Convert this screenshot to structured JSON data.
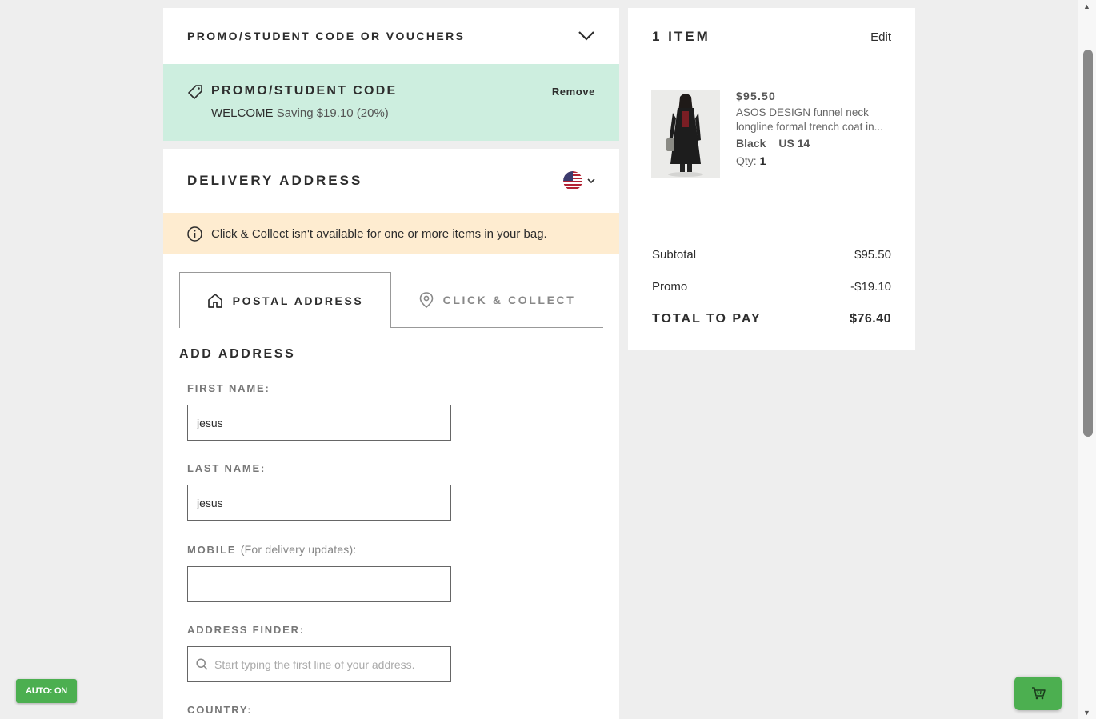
{
  "promo_section": {
    "title": "PROMO/STUDENT CODE OR VOUCHERS"
  },
  "promo_applied": {
    "title": "PROMO/STUDENT CODE",
    "code": "WELCOME",
    "saving": "Saving $19.10 (20%)",
    "remove_label": "Remove",
    "bg_color": "#cdeedf"
  },
  "delivery": {
    "title": "DELIVERY ADDRESS",
    "country_flag": "us-flag-icon",
    "notice": "Click & Collect isn't available for one or more items in your bag.",
    "tabs": [
      {
        "label": "POSTAL ADDRESS",
        "icon": "home-icon",
        "active": true
      },
      {
        "label": "CLICK & COLLECT",
        "icon": "location-pin-icon",
        "active": false
      }
    ],
    "add_address": "ADD ADDRESS",
    "fields": {
      "first_name_label": "FIRST NAME:",
      "first_name_value": "jesus",
      "last_name_label": "LAST NAME:",
      "last_name_value": "jesus",
      "mobile_label": "MOBILE",
      "mobile_hint": "(For delivery updates):",
      "mobile_value": "",
      "finder_label": "ADDRESS FINDER:",
      "finder_placeholder": "Start typing the first line of your address.",
      "country_label": "COUNTRY:"
    }
  },
  "summary": {
    "count": "1 ITEM",
    "edit_label": "Edit",
    "item": {
      "price": "$95.50",
      "name": "ASOS DESIGN funnel neck longline formal trench coat in...",
      "color": "Black",
      "size": "US 14",
      "qty_label": "Qty:",
      "qty": "1"
    },
    "subtotal_label": "Subtotal",
    "subtotal": "$95.50",
    "promo_label": "Promo",
    "promo": "-$19.10",
    "total_label": "TOTAL TO PAY",
    "total": "$76.40"
  },
  "overlay": {
    "auto_label": "AUTO: ON",
    "cart_icon": "cart-icon",
    "accent": "#4caf50"
  }
}
